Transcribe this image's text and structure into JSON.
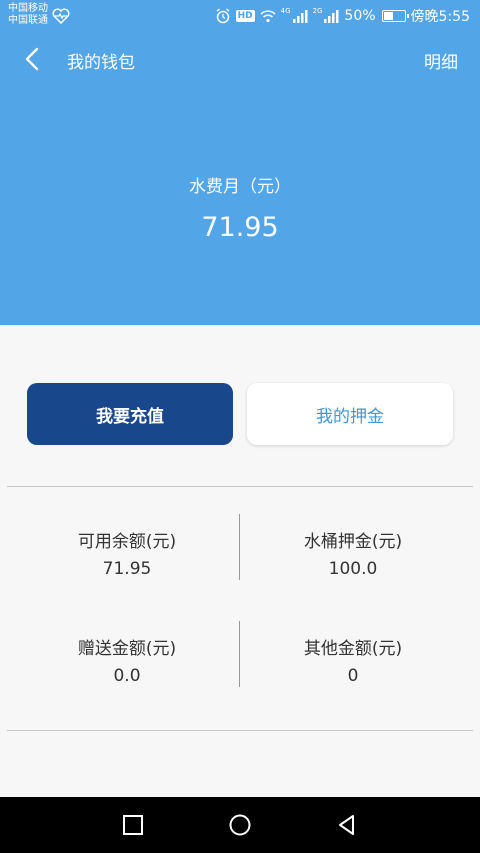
{
  "status_bar": {
    "carrier_1": "中国移动",
    "carrier_2": "中国联通",
    "net_1": "4G",
    "net_2": "2G",
    "battery_percent": "50%",
    "battery_level": 0.5,
    "time": "傍晚5:55",
    "hd_label": "HD",
    "icons": [
      "heart-health-icon",
      "alarm-icon",
      "hd-icon",
      "wifi-icon",
      "signal-icon",
      "battery-icon"
    ]
  },
  "app_bar": {
    "title": "我的钱包",
    "detail_label": "明细",
    "back_icon": "chevron-left-icon"
  },
  "balance": {
    "label": "水费月（元）",
    "value": "71.95"
  },
  "actions": {
    "recharge_label": "我要充值",
    "deposit_label": "我的押金"
  },
  "stats": {
    "available": {
      "label": "可用余额(元)",
      "value": "71.95"
    },
    "bucket_deposit": {
      "label": "水桶押金(元)",
      "value": "100.0"
    },
    "gift": {
      "label": "赠送金额(元)",
      "value": "0.0"
    },
    "other": {
      "label": "其他金额(元)",
      "value": "0"
    }
  },
  "nav_bar": {
    "icons": [
      "square-recents-icon",
      "circle-home-icon",
      "triangle-back-icon"
    ]
  },
  "colors": {
    "header_blue": "#52a5e6",
    "recharge_button": "#18478c",
    "deposit_text": "#3f98d9",
    "background": "#f7f7f7"
  }
}
